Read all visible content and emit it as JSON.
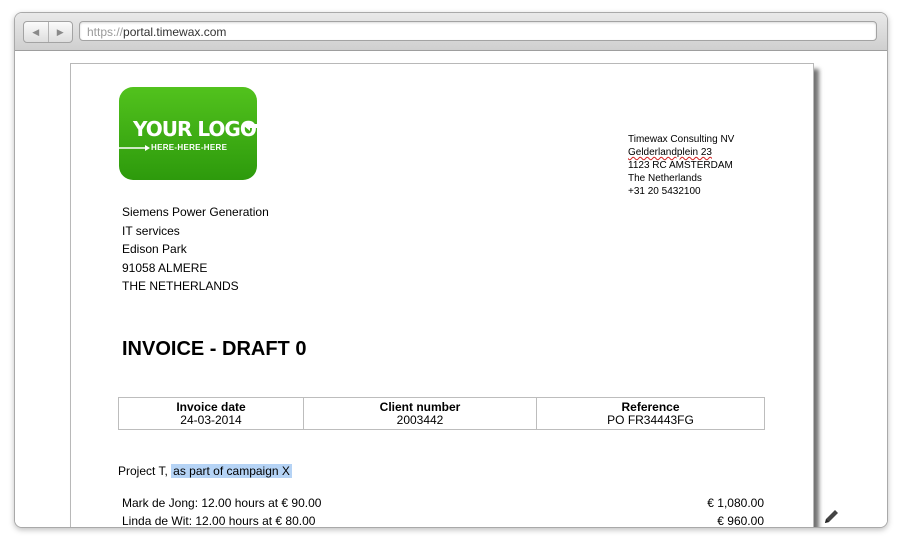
{
  "browser": {
    "url_protocol": "https://",
    "url_host": "portal.timewax.com",
    "back_icon": "back-arrow-icon",
    "forward_icon": "forward-arrow-icon"
  },
  "logo": {
    "text": "YOUR LOGO",
    "subtext": "HERE-HERE-HERE",
    "color": "#3aa814"
  },
  "company": {
    "name": "Timewax Consulting NV",
    "street": "Gelderlandplein 23",
    "postal_city": "1123 RC AMSTERDAM",
    "country": "The Netherlands",
    "phone": "+31 20 5432100"
  },
  "client": {
    "name": "Siemens Power Generation",
    "department": "IT services",
    "street": "Edison Park",
    "postal_city": "91058 ALMERE",
    "country": "THE NETHERLANDS"
  },
  "invoice": {
    "title": "INVOICE - DRAFT 0",
    "headers": {
      "date": "Invoice date",
      "client_number": "Client number",
      "reference": "Reference"
    },
    "values": {
      "date": "24-03-2014",
      "client_number": "2003442",
      "reference": "PO FR34443FG"
    }
  },
  "project": {
    "prefix": "Project T,",
    "highlighted": "as part of campaign X",
    "highlight_color": "#b5d3f5"
  },
  "lines": [
    {
      "description": "Mark de Jong: 12.00 hours at € 90.00",
      "amount": "€ 1,080.00"
    },
    {
      "description": "Linda de Wit: 12.00 hours at € 80.00",
      "amount": "€ 960.00"
    }
  ],
  "edit_icon": "pencil-icon"
}
